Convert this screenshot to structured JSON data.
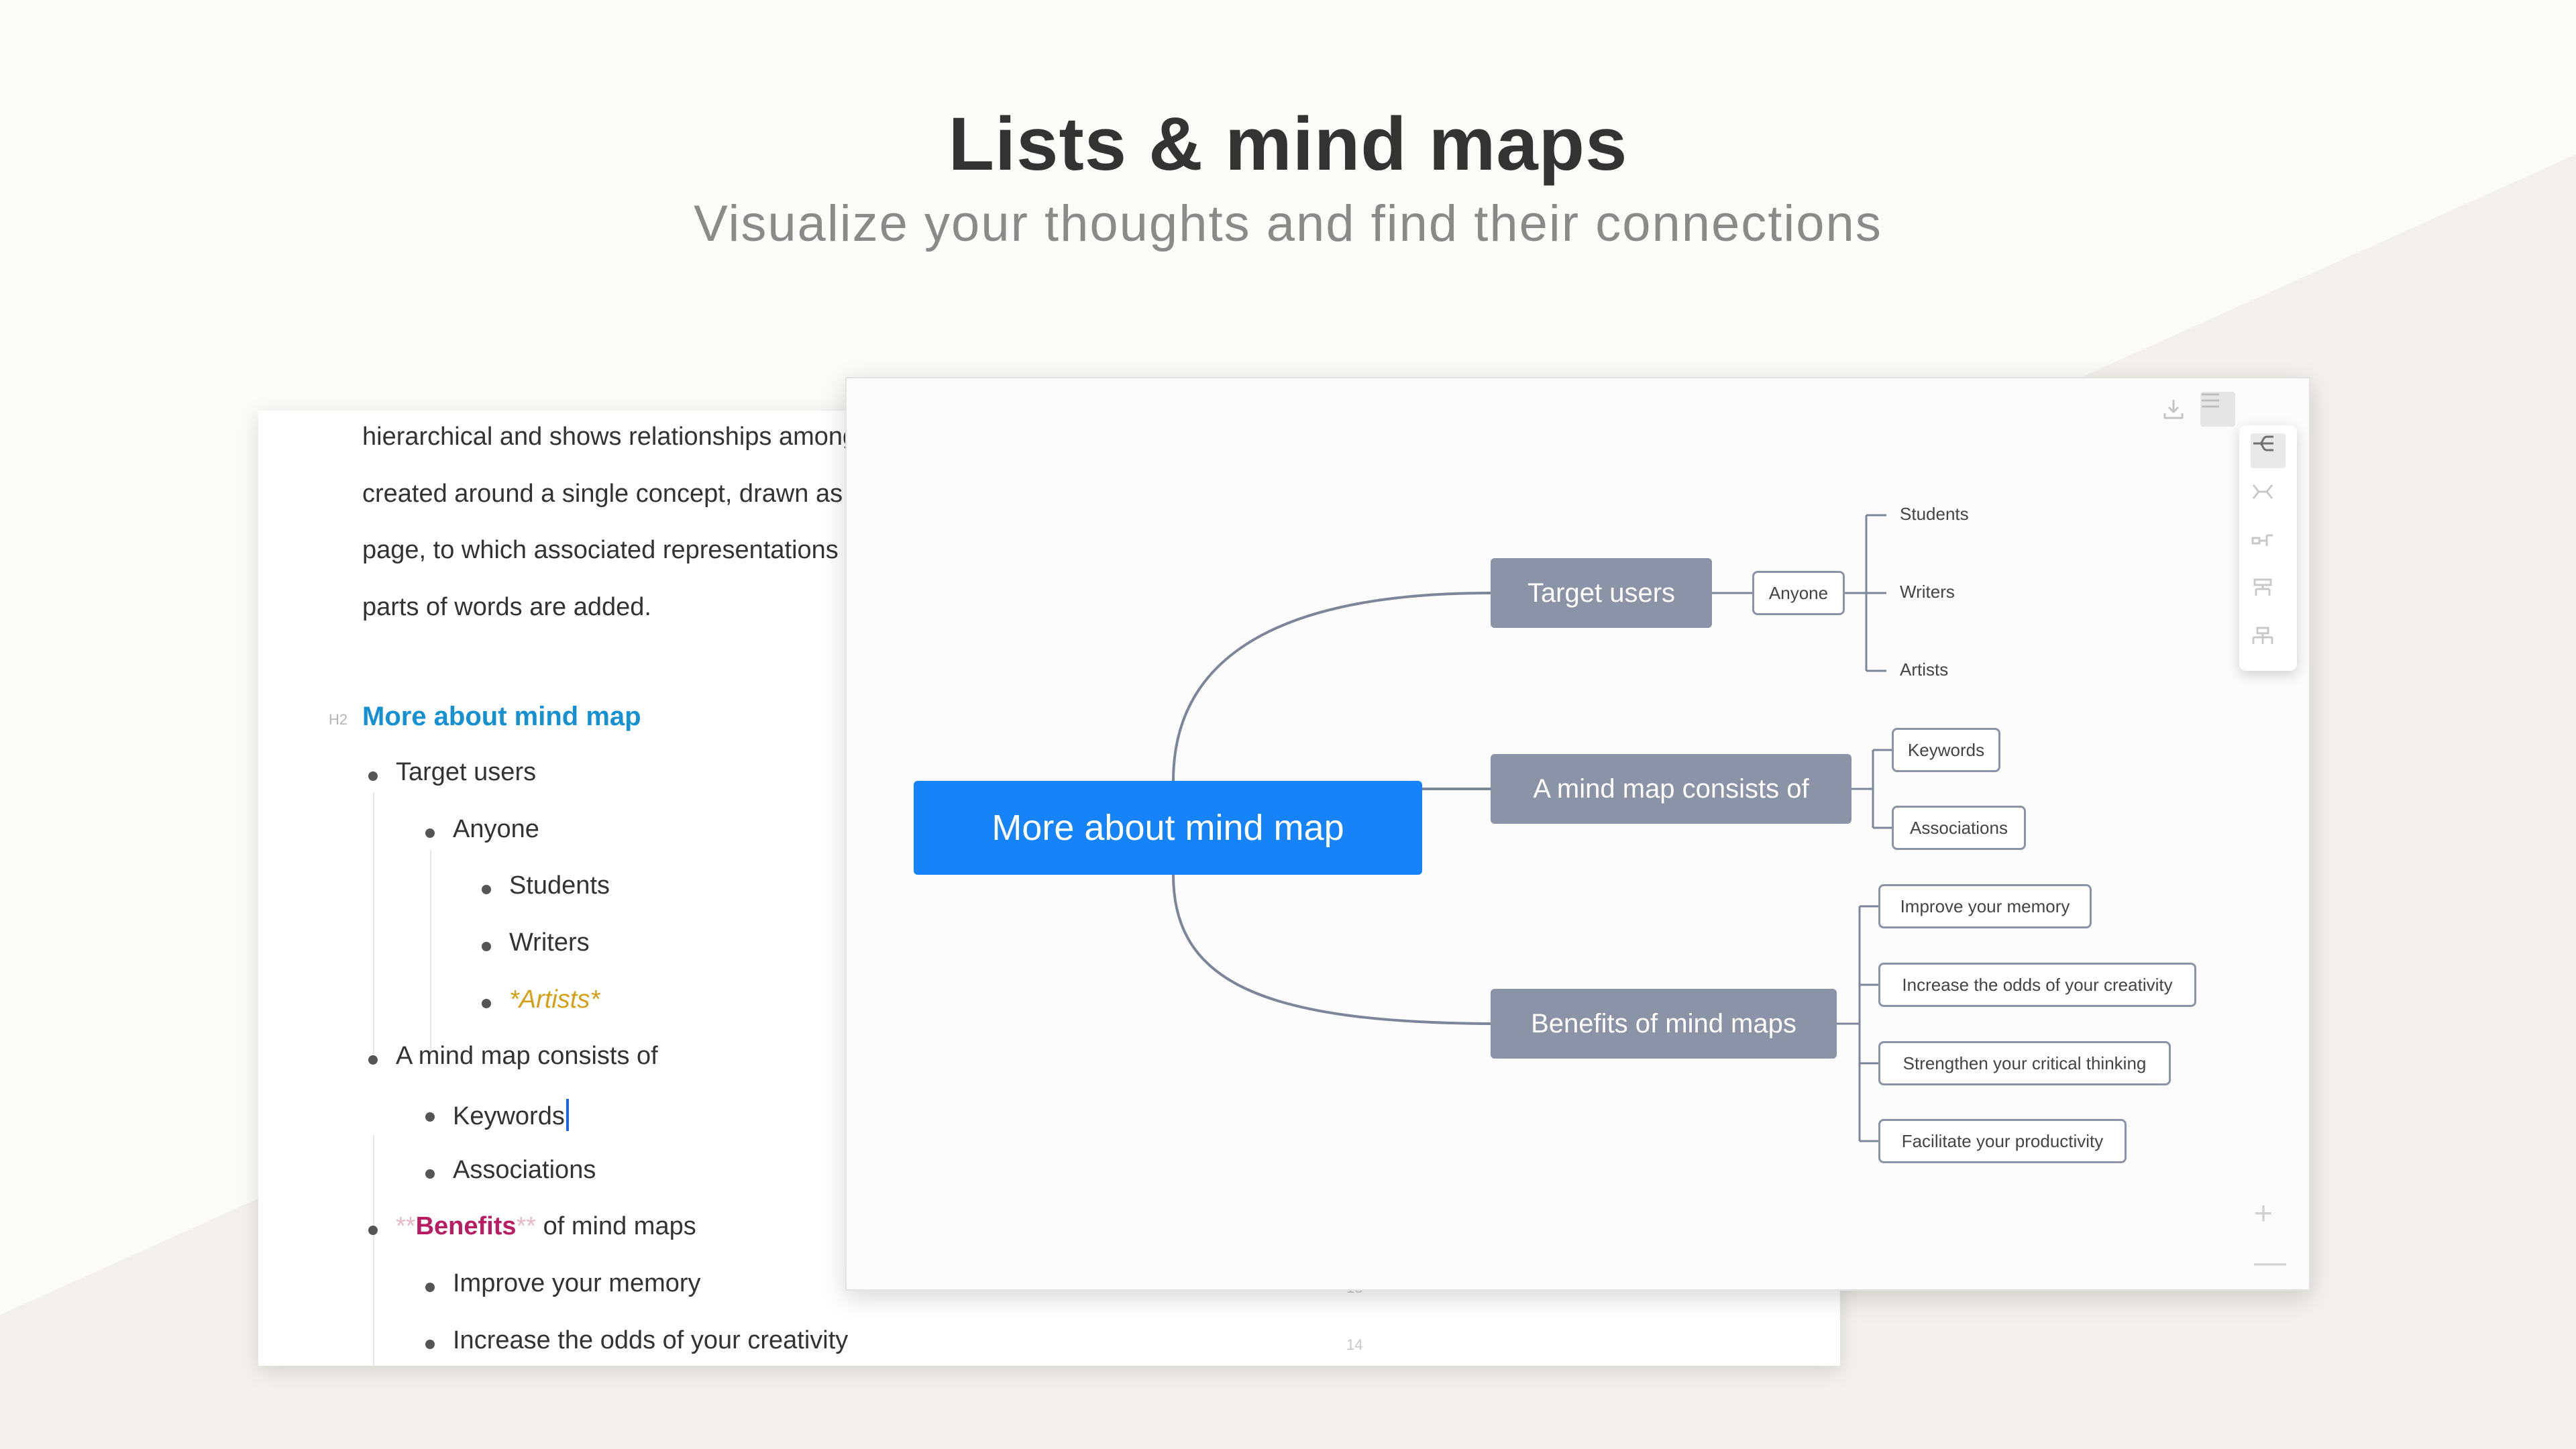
{
  "hero": {
    "title": "Lists & mind maps",
    "subtitle": "Visualize your thoughts and find their connections"
  },
  "editor": {
    "paragraph_lines": [
      "hierarchical and shows relationships among",
      "created around a single concept, drawn as",
      "page, to which associated representations",
      "parts of words are added."
    ],
    "heading_marker": "H2",
    "heading": "More about mind map",
    "list": {
      "target_users": "Target users",
      "anyone": "Anyone",
      "students": "Students",
      "writers": "Writers",
      "artists": "*Artists*",
      "consists": "A mind map consists of",
      "keywords": "Keywords",
      "associations": "Associations",
      "benefits_open_mark": "**",
      "benefits_word": "Benefits",
      "benefits_close_mark": "**",
      "benefits_rest": " of mind maps",
      "memory": "Improve your memory",
      "creativity": "Increase the odds of your creativity"
    },
    "line_numbers": [
      "13",
      "14"
    ]
  },
  "mindmap": {
    "root": "More about mind map",
    "branches": {
      "target_users": "Target users",
      "consists": "A mind map consists of",
      "benefits": "Benefits of mind maps"
    },
    "anyone": "Anyone",
    "students": "Students",
    "writers": "Writers",
    "artists": "Artists",
    "keywords": "Keywords",
    "associations": "Associations",
    "memory": "Improve your memory",
    "creativity": "Increase the odds of your creativity",
    "critical": "Strengthen your critical thinking",
    "productivity": "Facilitate your productivity",
    "zoom_in": "+",
    "zoom_out": "—"
  },
  "colors": {
    "root": "#1684f8",
    "branch": "#8a94a6",
    "heading": "#1590d0",
    "italic": "#d4a017",
    "bold": "#b81d63"
  },
  "icons": {
    "toolbar_toggle": "hamburger-icon",
    "download": "download-icon",
    "layout_right": "layout-right-icon",
    "layout_both": "layout-both-icon",
    "layout_org": "layout-org-icon",
    "layout_tree": "layout-tree-icon",
    "layout_tree_alt": "layout-tree-alt-icon"
  }
}
